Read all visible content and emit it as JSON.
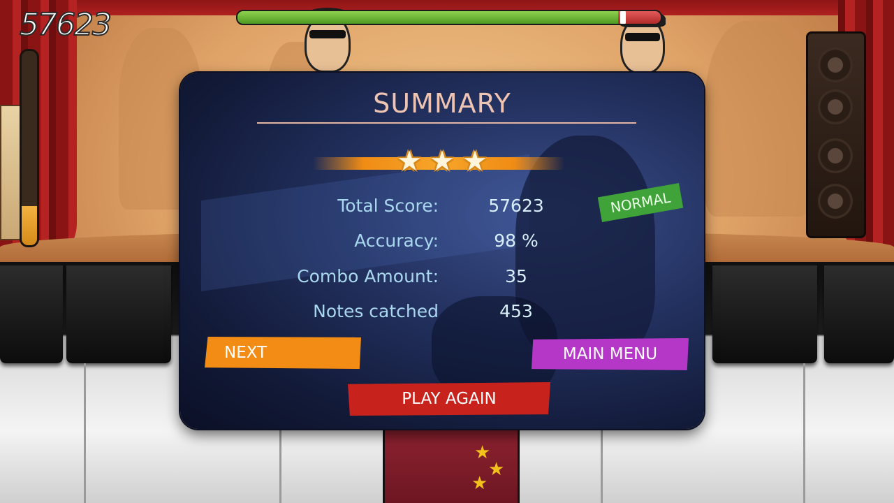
{
  "hud": {
    "score": "57623",
    "health_fraction": 0.9,
    "song_progress_fraction": 0.2
  },
  "summary": {
    "title": "SUMMARY",
    "stars_earned": 3,
    "stars_total": 3,
    "difficulty": "NORMAL",
    "stats": [
      {
        "label": "Total Score:",
        "value": "57623"
      },
      {
        "label": "Accuracy:",
        "value": "98 %"
      },
      {
        "label": "Combo Amount:",
        "value": "35"
      },
      {
        "label": "Notes catched",
        "value": "453"
      }
    ]
  },
  "buttons": {
    "next": "NEXT",
    "main_menu": "MAIN MENU",
    "play_again": "PLAY AGAIN"
  },
  "colors": {
    "next_button": "#f28c14",
    "main_menu_button": "#b437c7",
    "play_again_button": "#c8221c",
    "difficulty_badge": "#3fa33a",
    "star_strip": "#f08c14"
  }
}
